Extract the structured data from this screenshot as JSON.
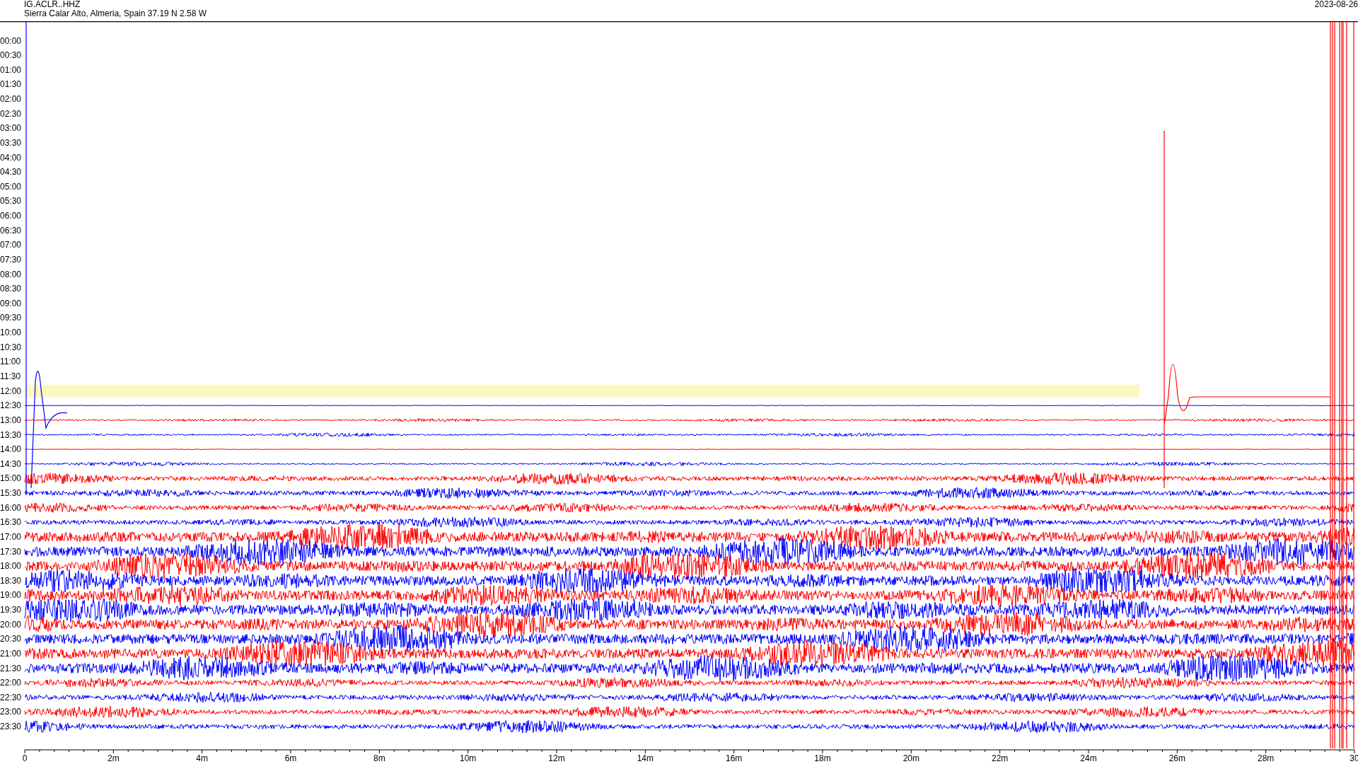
{
  "header": {
    "station": "IG.ACLR..HHZ",
    "location": "Sierra Calar Alto, Almeria, Spain  37.19 N 2.58 W",
    "date": "2023-08-26"
  },
  "helicorder": {
    "rows": [
      {
        "time": "00:00",
        "kind": "empty"
      },
      {
        "time": "00:30",
        "kind": "empty"
      },
      {
        "time": "01:00",
        "kind": "empty"
      },
      {
        "time": "01:30",
        "kind": "empty"
      },
      {
        "time": "02:00",
        "kind": "empty"
      },
      {
        "time": "02:30",
        "kind": "empty"
      },
      {
        "time": "03:00",
        "kind": "empty"
      },
      {
        "time": "03:30",
        "kind": "empty"
      },
      {
        "time": "04:00",
        "kind": "empty"
      },
      {
        "time": "04:30",
        "kind": "empty"
      },
      {
        "time": "05:00",
        "kind": "empty"
      },
      {
        "time": "05:30",
        "kind": "empty"
      },
      {
        "time": "06:00",
        "kind": "empty"
      },
      {
        "time": "06:30",
        "kind": "empty"
      },
      {
        "time": "07:00",
        "kind": "empty"
      },
      {
        "time": "07:30",
        "kind": "empty"
      },
      {
        "time": "08:00",
        "kind": "empty"
      },
      {
        "time": "08:30",
        "kind": "empty"
      },
      {
        "time": "09:00",
        "kind": "empty"
      },
      {
        "time": "09:30",
        "kind": "empty"
      },
      {
        "time": "10:00",
        "kind": "empty"
      },
      {
        "time": "10:30",
        "kind": "empty"
      },
      {
        "time": "11:00",
        "kind": "empty"
      },
      {
        "time": "11:30",
        "kind": "empty"
      },
      {
        "time": "12:00",
        "kind": "gap"
      },
      {
        "time": "12:30",
        "kind": "flat",
        "color": "#0000ff"
      },
      {
        "time": "13:00",
        "kind": "quiet",
        "color": "#ff0000"
      },
      {
        "time": "13:30",
        "kind": "quiet",
        "color": "#0000ff"
      },
      {
        "time": "14:00",
        "kind": "flat",
        "color": "#ff0000"
      },
      {
        "time": "14:30",
        "kind": "quiet",
        "color": "#0000ff"
      },
      {
        "time": "15:00",
        "kind": "moderate",
        "color": "#ff0000"
      },
      {
        "time": "15:30",
        "kind": "moderate",
        "color": "#0000ff"
      },
      {
        "time": "16:00",
        "kind": "moderate",
        "color": "#ff0000"
      },
      {
        "time": "16:30",
        "kind": "moderate",
        "color": "#0000ff"
      },
      {
        "time": "17:00",
        "kind": "strong",
        "color": "#ff0000"
      },
      {
        "time": "17:30",
        "kind": "strong",
        "color": "#0000ff"
      },
      {
        "time": "18:00",
        "kind": "strong",
        "color": "#ff0000"
      },
      {
        "time": "18:30",
        "kind": "strong",
        "color": "#0000ff"
      },
      {
        "time": "19:00",
        "kind": "strong",
        "color": "#ff0000"
      },
      {
        "time": "19:30",
        "kind": "strong",
        "color": "#0000ff"
      },
      {
        "time": "20:00",
        "kind": "strong",
        "color": "#ff0000"
      },
      {
        "time": "20:30",
        "kind": "strong",
        "color": "#0000ff"
      },
      {
        "time": "21:00",
        "kind": "strong",
        "color": "#ff0000"
      },
      {
        "time": "21:30",
        "kind": "strong",
        "color": "#0000ff"
      },
      {
        "time": "22:00",
        "kind": "moderate",
        "color": "#ff0000"
      },
      {
        "time": "22:30",
        "kind": "moderate",
        "color": "#0000ff"
      },
      {
        "time": "23:00",
        "kind": "moderate",
        "color": "#ff0000"
      },
      {
        "time": "23:30",
        "kind": "moderate",
        "color": "#0000ff"
      }
    ],
    "x_ticks": [
      "0",
      "2m",
      "4m",
      "6m",
      "8m",
      "10m",
      "12m",
      "14m",
      "16m",
      "18m",
      "20m",
      "22m",
      "24m",
      "26m",
      "28m",
      "30"
    ]
  }
}
